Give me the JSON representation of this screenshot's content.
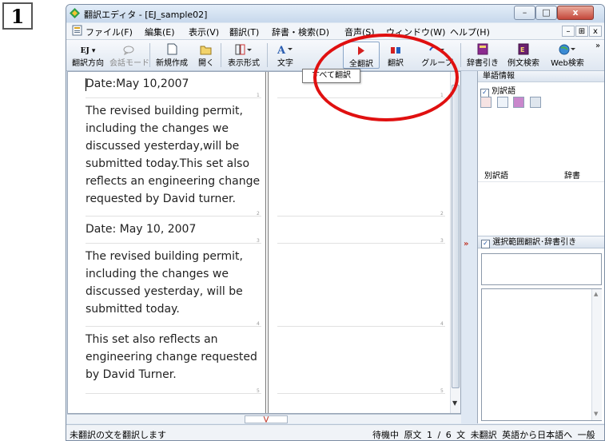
{
  "step_badge": "1",
  "window": {
    "title": "翻訳エディタ - [EJ_sample02]",
    "controls": {
      "minimize": "–",
      "maximize": "□",
      "close": "x"
    }
  },
  "menu": {
    "items": [
      "ファイル(F)",
      "編集(E)",
      "表示(V)",
      "翻訳(T)",
      "辞書・検索(D)",
      "音声(S)",
      "ウィンドウ(W)",
      "ヘルプ(H)"
    ],
    "mdi": [
      "–",
      "&#8862;",
      "x"
    ]
  },
  "toolbar": {
    "direction_top": "EJ ▾",
    "direction": "翻訳方向",
    "conversation_mode": "会話モード",
    "new": "新規作成",
    "open": "開く",
    "display_format": "表示形式",
    "text": "文字",
    "translate_all": "全翻訳",
    "translate": "翻訳",
    "group": "グループ",
    "dictionary_lookup": "辞書引き",
    "example_search": "例文検索",
    "web_search": "Web検索",
    "overflow": "»"
  },
  "tooltip": "すべて翻訳",
  "editor": {
    "segments": [
      {
        "lines": [
          "Date:May 10,2007"
        ],
        "num": "1"
      },
      {
        "lines": [
          "The revised building permit,",
          "including the changes we",
          "discussed yesterday,will be",
          "submitted today.This set also",
          "reflects an engineering change",
          "requested by David turner."
        ],
        "num": "2"
      },
      {
        "lines": [
          "Date: May 10, 2007"
        ],
        "num": "3"
      },
      {
        "lines": [
          "The revised building permit,",
          "including the changes we",
          "discussed yesterday, will be",
          "submitted today."
        ],
        "num": "4"
      },
      {
        "lines": [
          "This set also reflects an",
          "engineering change requested",
          "by David Turner."
        ],
        "num": "5"
      }
    ]
  },
  "right_panel": {
    "header": "単語情報",
    "alt_words_checkbox": "別訳語",
    "alt_words_checked": true,
    "col_alt_word": "別訳語",
    "col_dictionary": "辞書",
    "selection_checkbox": "選択範囲翻訳･辞書引き",
    "selection_checked": true
  },
  "status": {
    "left": "未翻訳の文を翻訳します",
    "right": "待機中 原文 1 / 6 文 未翻訳 英語から日本語へ 一般"
  },
  "colors": {
    "highlight_ellipse": "#e01010",
    "translate_all_icon": "#d42020",
    "translate_icon_left": "#d42020",
    "translate_icon_right": "#2060c0"
  }
}
